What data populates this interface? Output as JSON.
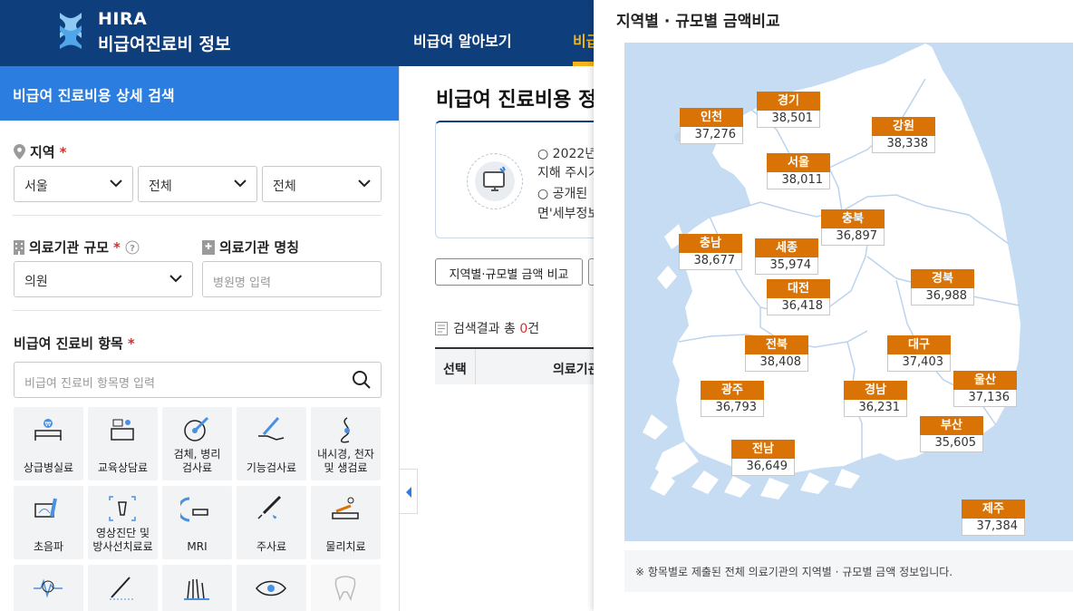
{
  "header": {
    "logo_title": "HIRA",
    "logo_subtitle": "비급여진료비 정보",
    "nav": [
      "비급여 알아보기",
      "비급여"
    ]
  },
  "sidebar": {
    "title": "비급여 진료비용 상세 검색",
    "region_label": "지역",
    "region_selects": [
      "서울",
      "전체",
      "전체"
    ],
    "scale_label": "의료기관 규모",
    "scale_value": "의원",
    "name_label": "의료기관 명칭",
    "name_placeholder": "병원명 입력",
    "item_label": "비급여 진료비 항목",
    "item_placeholder": "비급여 진료비 항목명 입력",
    "items": [
      {
        "label": "상급병실료",
        "icon": "hospital-bed-icon"
      },
      {
        "label": "교육상담료",
        "icon": "counseling-icon"
      },
      {
        "label": "검체, 병리\n검사료",
        "icon": "specimen-icon"
      },
      {
        "label": "기능검사료",
        "icon": "thermometer-hand-icon"
      },
      {
        "label": "내시경, 천자\n및 생검료",
        "icon": "endoscope-icon"
      },
      {
        "label": "초음파",
        "icon": "ultrasound-icon"
      },
      {
        "label": "영상진단 및\n방사선치료료",
        "icon": "xray-icon"
      },
      {
        "label": "MRI",
        "icon": "mri-icon"
      },
      {
        "label": "주사료",
        "icon": "syringe-icon"
      },
      {
        "label": "물리치료",
        "icon": "physical-therapy-icon"
      },
      {
        "label": "",
        "icon": "heartbeat-icon"
      },
      {
        "label": "",
        "icon": "surgery-icon"
      },
      {
        "label": "",
        "icon": "hair-icon"
      },
      {
        "label": "",
        "icon": "eye-icon"
      },
      {
        "label": "",
        "icon": "tooth-icon"
      }
    ]
  },
  "main": {
    "title": "비급여 진료비용 정보",
    "info_lines": [
      "○ 2022년",
      "지해 주시기",
      "○ 공개된",
      "면'세부정보"
    ],
    "compare_button": "지역별·규모별 금액 비교",
    "result_prefix": "검색결과 총 ",
    "result_count": "0",
    "result_suffix": "건",
    "table_headers": [
      "선택",
      "의료기관"
    ]
  },
  "panel": {
    "title": "지역별 · 규모별 금액비교",
    "note": "※ 항목별로 제출된 전체 의료기관의 지역별 · 규모별 금액 정보입니다.",
    "regions": [
      {
        "name": "인천",
        "value": "37,276"
      },
      {
        "name": "경기",
        "value": "38,501"
      },
      {
        "name": "강원",
        "value": "38,338"
      },
      {
        "name": "서울",
        "value": "38,011"
      },
      {
        "name": "충북",
        "value": "36,897"
      },
      {
        "name": "충남",
        "value": "38,677"
      },
      {
        "name": "세종",
        "value": "35,974"
      },
      {
        "name": "경북",
        "value": "36,988"
      },
      {
        "name": "대전",
        "value": "36,418"
      },
      {
        "name": "전북",
        "value": "38,408"
      },
      {
        "name": "대구",
        "value": "37,403"
      },
      {
        "name": "광주",
        "value": "36,793"
      },
      {
        "name": "경남",
        "value": "36,231"
      },
      {
        "name": "울산",
        "value": "37,136"
      },
      {
        "name": "부산",
        "value": "35,605"
      },
      {
        "name": "전남",
        "value": "36,649"
      },
      {
        "name": "제주",
        "value": "37,384"
      }
    ]
  },
  "colors": {
    "header": "#0f3e7c",
    "sidebar_title": "#2b7de0",
    "accent": "#f3b41c",
    "badge": "#d97306",
    "map_sea": "#c6dcf3"
  }
}
